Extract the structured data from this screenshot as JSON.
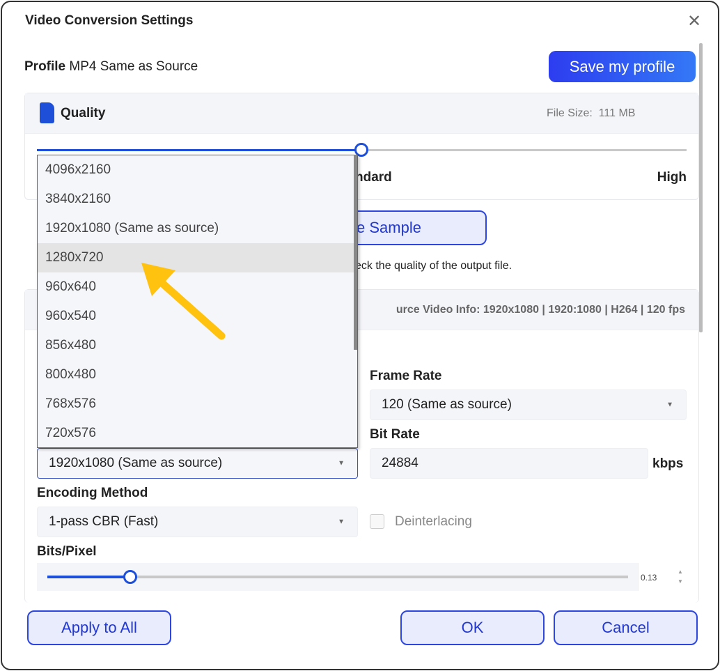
{
  "dialog": {
    "title": "Video Conversion Settings",
    "close_icon": "close-icon"
  },
  "profile": {
    "label": "Profile",
    "value": "MP4 Same as Source",
    "save_label": "Save my profile"
  },
  "quality": {
    "title": "Quality",
    "file_size_label": "File Size:",
    "file_size_value": "111 MB",
    "slider_percent": 50,
    "label_mid_partial": "ndard",
    "label_high": "High",
    "sample_button_partial": "e Sample",
    "hint_partial": "eck the quality of the output file."
  },
  "video_info": {
    "text_partial": "urce Video Info: 1920x1080 | 1920:1080 | H264 | 120 fps"
  },
  "resolution": {
    "selected": "1920x1080 (Same as source)",
    "options": [
      "4096x2160",
      "3840x2160",
      "1920x1080 (Same as source)",
      "1280x720",
      "960x640",
      "960x540",
      "856x480",
      "800x480",
      "768x576",
      "720x576"
    ],
    "highlighted_index": 3
  },
  "frame_rate": {
    "label": "Frame Rate",
    "value": "120 (Same as source)"
  },
  "bit_rate": {
    "label": "Bit Rate",
    "value": "24884",
    "unit": "kbps"
  },
  "encoding": {
    "label": "Encoding Method",
    "value": "1-pass CBR (Fast)"
  },
  "deinterlacing": {
    "label": "Deinterlacing",
    "checked": false
  },
  "bits_pixel": {
    "label": "Bits/Pixel",
    "value": "0.13"
  },
  "footer": {
    "apply_all": "Apply to All",
    "ok": "OK",
    "cancel": "Cancel"
  },
  "colors": {
    "accent": "#1d4fd8",
    "annotation_arrow": "#ffc20e"
  }
}
